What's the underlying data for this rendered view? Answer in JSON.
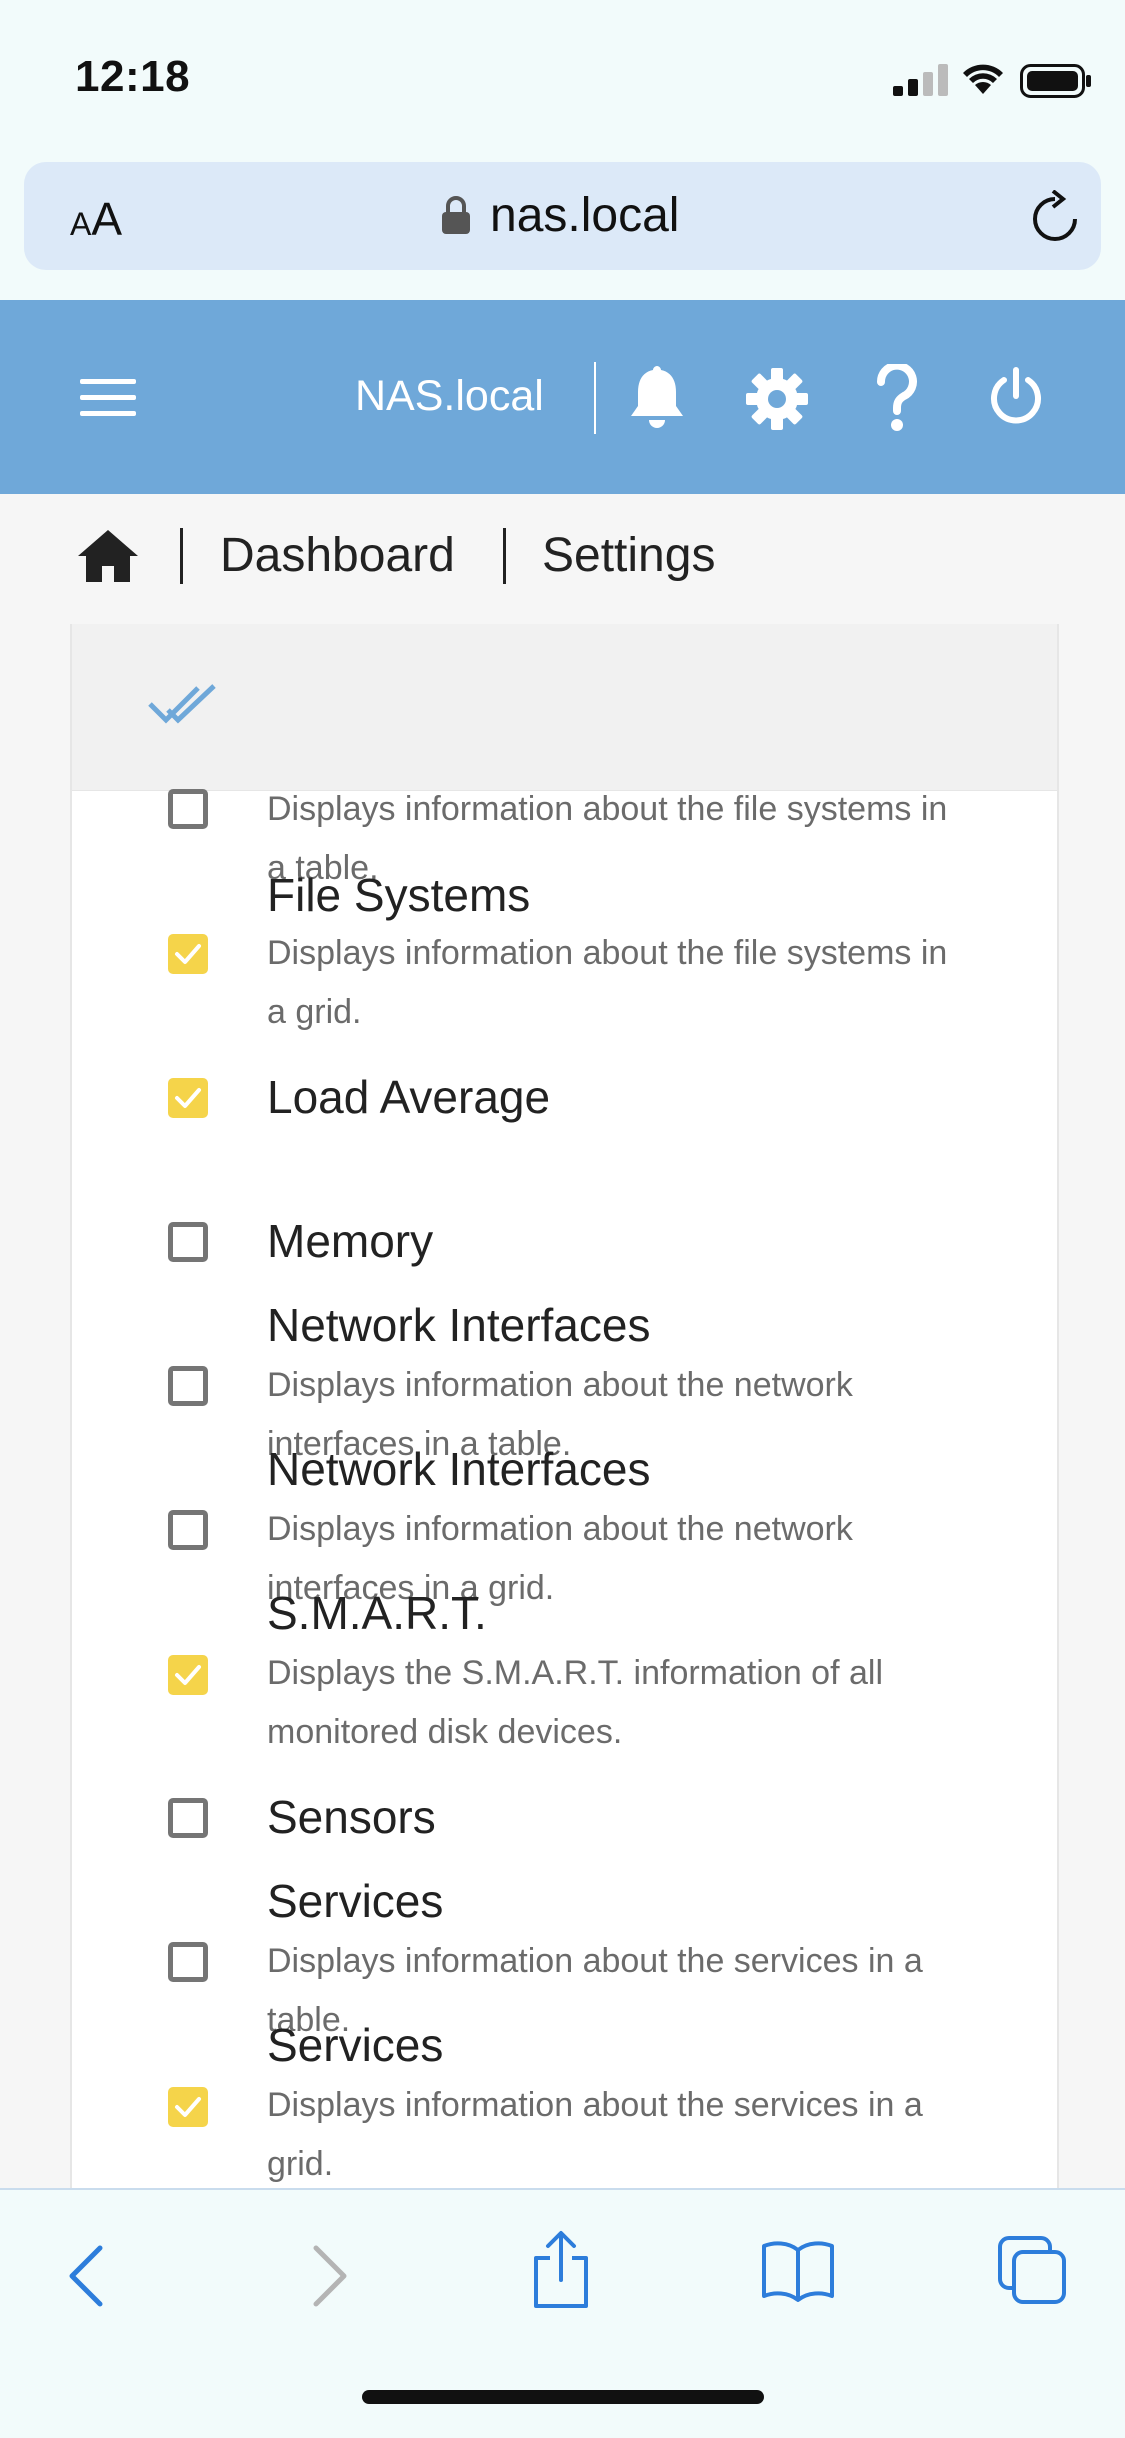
{
  "status_bar": {
    "time": "12:18"
  },
  "browser": {
    "text_size_label_small": "A",
    "text_size_label_large": "A",
    "url": "nas.local"
  },
  "header": {
    "host": "NAS.local"
  },
  "breadcrumb": {
    "items": [
      "Dashboard",
      "Settings"
    ]
  },
  "colors": {
    "header_bg": "#6fa8d9",
    "checkbox_on": "#f5d44a",
    "accent_check": "#6fa8d9"
  },
  "icons": [
    "menu-icon",
    "bell-icon",
    "gear-icon",
    "help-icon",
    "power-icon",
    "home-icon",
    "check-all-icon",
    "back-icon",
    "forward-icon",
    "share-icon",
    "bookmarks-icon",
    "tabs-icon"
  ],
  "widgets": [
    {
      "title": "",
      "desc": "Displays information about the file systems in a table.",
      "checked": false
    },
    {
      "title": "File Systems",
      "desc": "Displays information about the file systems in a grid.",
      "checked": true
    },
    {
      "title": "Load Average",
      "desc": "",
      "checked": true
    },
    {
      "title": "Memory",
      "desc": "",
      "checked": false
    },
    {
      "title": "Network Interfaces",
      "desc": "Displays information about the network interfaces in a table.",
      "checked": false
    },
    {
      "title": "Network Interfaces",
      "desc": "Displays information about the network interfaces in a grid.",
      "checked": false
    },
    {
      "title": "S.M.A.R.T.",
      "desc": "Displays the S.M.A.R.T. information of all monitored disk devices.",
      "checked": true
    },
    {
      "title": "Sensors",
      "desc": "",
      "checked": false
    },
    {
      "title": "Services",
      "desc": "Displays information about the services in a table.",
      "checked": false
    },
    {
      "title": "Services",
      "desc": "Displays information about the services in a grid.",
      "checked": true
    }
  ]
}
